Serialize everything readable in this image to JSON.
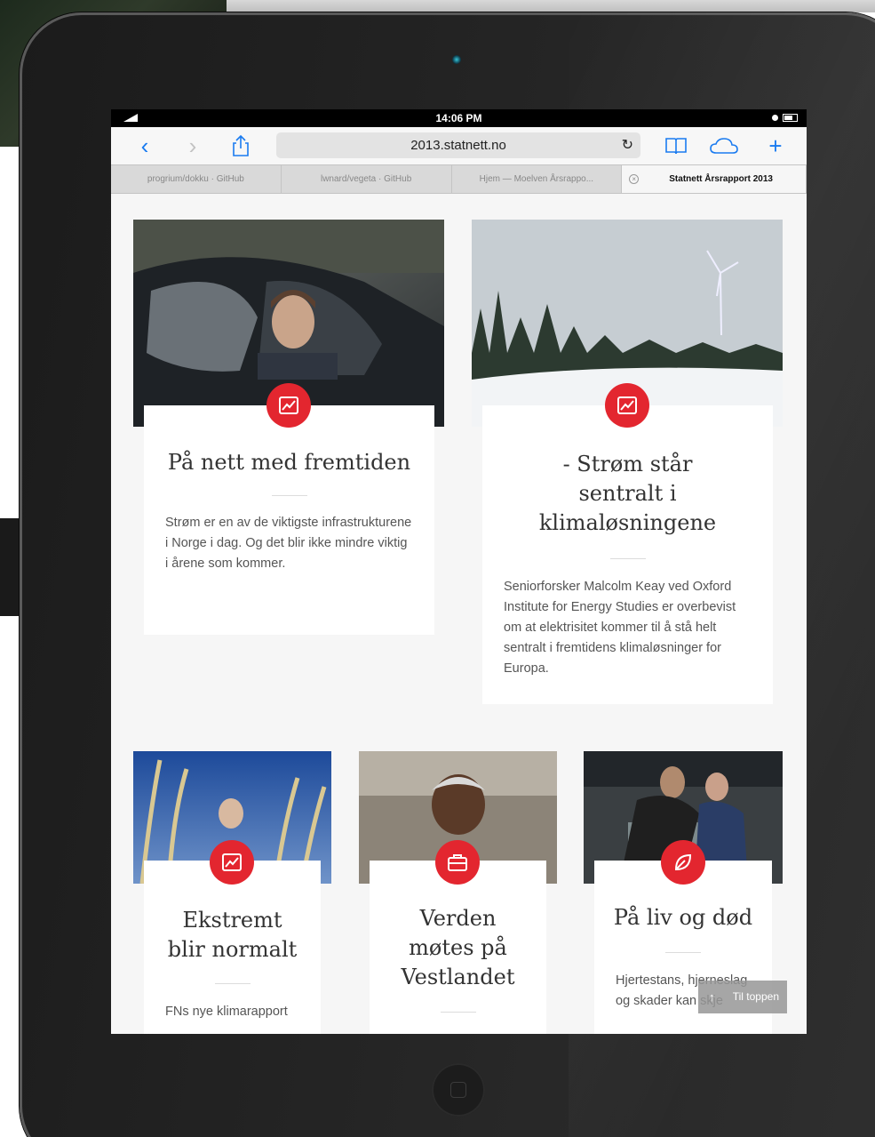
{
  "status_bar": {
    "time": "14:06 PM"
  },
  "toolbar": {
    "url": "2013.statnett.no"
  },
  "tabs": [
    {
      "label": "progrium/dokku · GitHub"
    },
    {
      "label": "lwnard/vegeta · GitHub"
    },
    {
      "label": "Hjem — Moelven Årsrappo..."
    },
    {
      "label": "Statnett Årsrapport 2013"
    }
  ],
  "articles": [
    {
      "title": "På nett med fremtiden",
      "icon": "chart-icon",
      "text": "Strøm er en av de viktigste infrastrukturene i Norge i dag. Og det blir ikke mindre viktig i årene som kommer."
    },
    {
      "title": "- Strøm står sentralt i klimaløsningene",
      "icon": "chart-icon",
      "text": "Seniorforsker Malcolm Keay ved Oxford Institute for Energy Studies er overbevist om at elektrisitet kommer til å stå helt sentralt i fremtidens klimaløsninger for Europa."
    },
    {
      "title": "Ekstremt blir normalt",
      "icon": "chart-icon",
      "text": "FNs nye klimarapport"
    },
    {
      "title": "Verden møtes på Vestlandet",
      "icon": "briefcase-icon",
      "text": ""
    },
    {
      "title": "På liv og død",
      "icon": "leaf-icon",
      "text": "Hjertestans, hjerneslag og skader kan skje"
    }
  ],
  "to_top": {
    "label": "Til toppen"
  },
  "colors": {
    "accent": "#e3262f",
    "ios_blue": "#1a7bf0"
  }
}
